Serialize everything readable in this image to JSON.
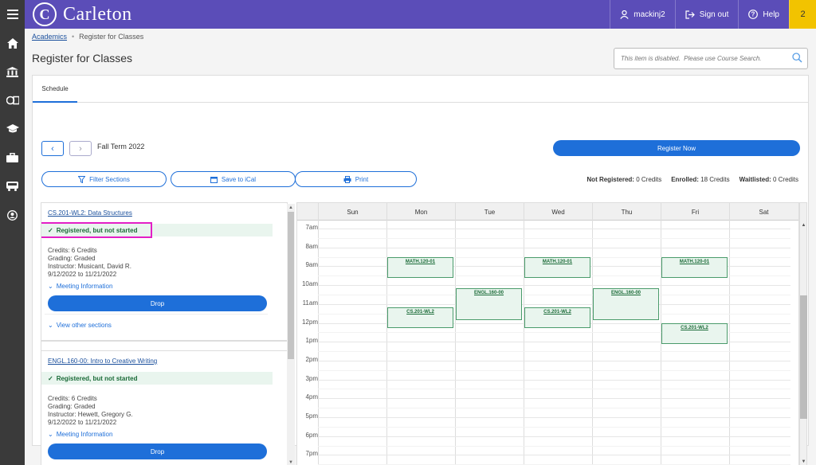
{
  "app": {
    "brand": "Carleton",
    "seal_letter": "C"
  },
  "topnav": {
    "user": "mackinj2",
    "signout": "Sign out",
    "help": "Help",
    "notifications": "2"
  },
  "breadcrumb": {
    "root": "Academics",
    "current": "Register for Classes"
  },
  "page": {
    "title": "Register for Classes"
  },
  "search": {
    "placeholder": "This item is disabled.  Please use Course Search."
  },
  "tabs": {
    "schedule": "Schedule"
  },
  "term": {
    "label": "Fall Term 2022"
  },
  "actions": {
    "register_now": "Register Now",
    "filter": "Filter Sections",
    "ical": "Save to iCal",
    "print": "Print"
  },
  "credits": {
    "not_registered_label": "Not Registered:",
    "not_registered_value": "0 Credits",
    "enrolled_label": "Enrolled:",
    "enrolled_value": "18 Credits",
    "waitlisted_label": "Waitlisted:",
    "waitlisted_value": "0 Credits"
  },
  "courses": [
    {
      "title": "CS.201-WL2: Data Structures",
      "status": "Registered, but not started",
      "credits": "Credits: 6 Credits",
      "grading": "Grading: Graded",
      "instructor": "Instructor: Musicant, David R.",
      "dates": "9/12/2022 to 11/21/2022",
      "meeting": "Meeting Information",
      "drop": "Drop",
      "other": "View other sections"
    },
    {
      "title": "ENGL.160-00: Intro to Creative Writing",
      "status": "Registered, but not started",
      "credits": "Credits: 6 Credits",
      "grading": "Grading: Graded",
      "instructor": "Instructor: Hewett, Gregory G.",
      "dates": "9/12/2022 to 11/21/2022",
      "meeting": "Meeting Information",
      "drop": "Drop"
    }
  ],
  "calendar": {
    "days": [
      "Sun",
      "Mon",
      "Tue",
      "Wed",
      "Thu",
      "Fri",
      "Sat"
    ],
    "times": [
      "7am",
      "8am",
      "9am",
      "10am",
      "11am",
      "12pm",
      "1pm",
      "2pm",
      "3pm",
      "4pm",
      "5pm",
      "6pm",
      "7pm"
    ],
    "events": [
      {
        "label": "MATH.120-01",
        "day": "Mon",
        "start": "8:30am"
      },
      {
        "label": "MATH.120-01",
        "day": "Wed",
        "start": "8:30am"
      },
      {
        "label": "MATH.120-01",
        "day": "Fri",
        "start": "8:30am"
      },
      {
        "label": "ENGL.160-00",
        "day": "Tue",
        "start": "10:10am"
      },
      {
        "label": "ENGL.160-00",
        "day": "Thu",
        "start": "10:10am"
      },
      {
        "label": "CS.201-WL2",
        "day": "Mon",
        "start": "11:10am"
      },
      {
        "label": "CS.201-WL2",
        "day": "Wed",
        "start": "11:10am"
      },
      {
        "label": "CS.201-WL2",
        "day": "Fri",
        "start": "12pm"
      }
    ]
  }
}
